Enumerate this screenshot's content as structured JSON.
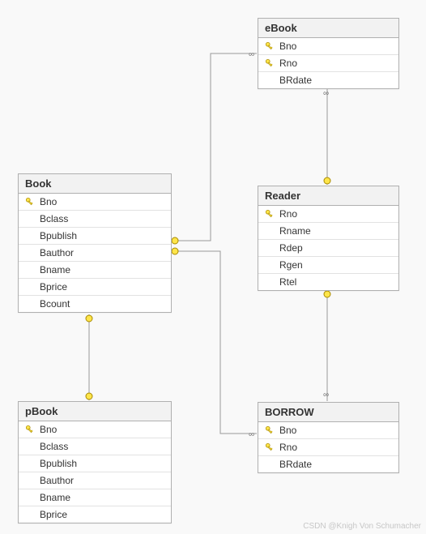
{
  "entities": {
    "book": {
      "title": "Book",
      "cols": [
        "Bno",
        "Bclass",
        "Bpublish",
        "Bauthor",
        "Bname",
        "Bprice",
        "Bcount"
      ],
      "keys": [
        "Bno"
      ]
    },
    "ebook": {
      "title": "eBook",
      "cols": [
        "Bno",
        "Rno",
        "BRdate"
      ],
      "keys": [
        "Bno",
        "Rno"
      ]
    },
    "reader": {
      "title": "Reader",
      "cols": [
        "Rno",
        "Rname",
        "Rdep",
        "Rgen",
        "Rtel"
      ],
      "keys": [
        "Rno"
      ]
    },
    "borrow": {
      "title": "BORROW",
      "cols": [
        "Bno",
        "Rno",
        "BRdate"
      ],
      "keys": [
        "Bno",
        "Rno"
      ]
    },
    "pbook": {
      "title": "pBook",
      "cols": [
        "Bno",
        "Bclass",
        "Bpublish",
        "Bauthor",
        "Bname",
        "Bprice"
      ],
      "keys": [
        "Bno"
      ]
    }
  },
  "watermark": "CSDN @Knigh Von Schumacher",
  "key_icon_label": "primary-key"
}
